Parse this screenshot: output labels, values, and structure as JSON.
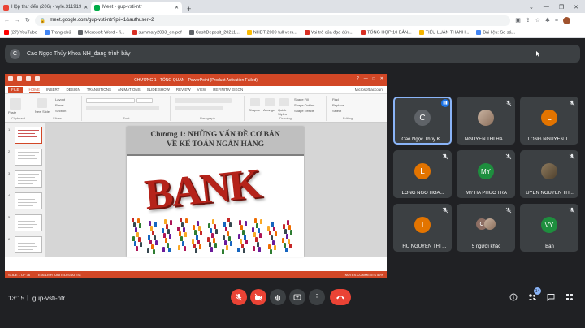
{
  "browser": {
    "tabs": [
      {
        "label": "Hộp thư đến (206) - vyle.311919",
        "color": "#ea4335",
        "active": false
      },
      {
        "label": "Meet - gup-vsti-ntr",
        "color": "#00ac47",
        "active": true
      }
    ],
    "new_tab": "+",
    "url": "meet.google.com/gup-vsti-ntr?pli=1&authuser=2",
    "bookmarks": [
      {
        "label": "(27) YouTube",
        "color": "#ff0000"
      },
      {
        "label": "Trang chủ",
        "color": "#4285f4"
      },
      {
        "label": "Microsoft Word - fi...",
        "color": "#5f6368"
      },
      {
        "label": "summary2003_en.pdf",
        "color": "#d93025"
      },
      {
        "label": "CashDeposit_20211...",
        "color": "#5f6368"
      },
      {
        "label": "NHDT 2009 full vers...",
        "color": "#fbbc04"
      },
      {
        "label": "Vai trò của đạo đức...",
        "color": "#d93025"
      },
      {
        "label": "TỔNG HỢP 10 BẢN...",
        "color": "#d93025"
      },
      {
        "label": "TIỂU LUẬN THANH...",
        "color": "#f4b400"
      },
      {
        "label": "Bài liệu: So sá...",
        "color": "#4285f4"
      }
    ]
  },
  "presenting": {
    "avatar": "C",
    "text": "Cao Ngọc Thủy Khoa NH_đang trình bày"
  },
  "powerpoint": {
    "title": "CHƯƠNG 1 - TỔNG QUAN - PowerPoint (Product Activation Failed)",
    "menu": [
      "FILE",
      "HOME",
      "INSERT",
      "DESIGN",
      "TRANSITIONS",
      "ANIMATIONS",
      "SLIDE SHOW",
      "REVIEW",
      "VIEW",
      "REFINITIV EIKON"
    ],
    "account": "Microsoft account",
    "ribbon": {
      "clipboard": "Clipboard",
      "slides": "Slides",
      "font": "Font",
      "paragraph": "Paragraph",
      "drawing": "Drawing",
      "editing": "Editing",
      "paste": "Paste",
      "new_slide": "New Slide",
      "layout": "Layout",
      "reset": "Reset",
      "section": "Section",
      "shapes": "Shapes",
      "arrange": "Arrange",
      "quick_styles": "Quick Styles",
      "shape_fill": "Shape Fill",
      "shape_outline": "Shape Outline",
      "shape_effects": "Shape Effects",
      "find": "Find",
      "replace": "Replace",
      "select": "Select"
    },
    "slide_numbers": [
      "1",
      "2",
      "3",
      "4",
      "5",
      "6"
    ],
    "slide_title_1": "Chương 1: NHỮNG VẤN ĐỀ CƠ BẢN",
    "slide_title_2": "VỀ KẾ TOÁN NGÂN HÀNG",
    "bank_word": "BANK",
    "status_left": "SLIDE 1 OF 36",
    "status_lang": "ENGLISH (UNITED STATES)",
    "status_right": "NOTES   COMMENTS   52%"
  },
  "participants": [
    {
      "name": "Cao Ngọc Thủy K...",
      "initial": "C",
      "color": "#5f6368",
      "photo": false,
      "speaking": true
    },
    {
      "name": "NGUYEN THI HA ...",
      "initial": "",
      "color": "",
      "photo": true,
      "speaking": false
    },
    {
      "name": "LONG NGUYEN T...",
      "initial": "L",
      "color": "#e37400",
      "photo": false,
      "speaking": false
    },
    {
      "name": "LONG NGO HOA...",
      "initial": "L",
      "color": "#e37400",
      "photo": false,
      "speaking": false
    },
    {
      "name": "MY HA PHUC TRA",
      "initial": "MY",
      "color": "#1e8e3e",
      "photo": false,
      "speaking": false
    },
    {
      "name": "UYEN NGUYEN TH...",
      "initial": "",
      "color": "",
      "photo": true,
      "speaking": false
    },
    {
      "name": "THU NGUYEN THI ...",
      "initial": "T",
      "color": "#e37400",
      "photo": false,
      "speaking": false
    },
    {
      "name": "5 người khác",
      "initial": "C",
      "color": "#8d6e63",
      "photo": false,
      "speaking": false,
      "group": true
    },
    {
      "name": "Bạn",
      "initial": "VY",
      "color": "#1e8e3e",
      "photo": false,
      "speaking": false
    }
  ],
  "meeting": {
    "time": "13:15",
    "separator": "|",
    "code": "gup-vsti-ntr",
    "people_count": "14"
  },
  "colors": {
    "meet_bg": "#202124",
    "tile_bg": "#3c4043",
    "danger": "#ea4335",
    "ppt_accent": "#d24726",
    "active_outline": "#8ab4f8"
  }
}
